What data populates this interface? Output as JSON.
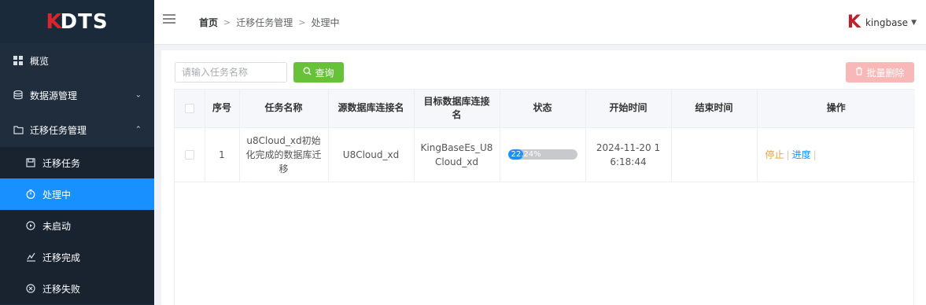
{
  "sidebar": {
    "logo_mark": "K",
    "logo_text": "DTS",
    "items": [
      {
        "label": "概览"
      },
      {
        "label": "数据源管理"
      },
      {
        "label": "迁移任务管理"
      }
    ],
    "sub_items": [
      {
        "label": "迁移任务"
      },
      {
        "label": "处理中"
      },
      {
        "label": "未启动"
      },
      {
        "label": "迁移完成"
      },
      {
        "label": "迁移失败"
      }
    ]
  },
  "breadcrumb": {
    "home": "首页",
    "level1": "迁移任务管理",
    "level2": "处理中"
  },
  "user": {
    "logo_mark": "K",
    "name": "kingbase"
  },
  "toolbar": {
    "search_placeholder": "请输入任务名称",
    "query_label": "查询",
    "batch_delete_label": "批量删除"
  },
  "table": {
    "columns": [
      "序号",
      "任务名称",
      "源数据库连接名",
      "目标数据库连接名",
      "状态",
      "开始时间",
      "结束时间",
      "操作"
    ],
    "rows": [
      {
        "index": "1",
        "task_name": "u8Cloud_xd初始化完成的数据库迁移",
        "source": "U8Cloud_xd",
        "target": "KingBaseEs_U8Cloud_xd",
        "progress_text": "22.24%",
        "progress_value": 22.24,
        "start_time": "2024-11-20 16:18:44",
        "end_time": "",
        "op_stop": "停止",
        "op_progress": "进度"
      }
    ]
  },
  "colors": {
    "sidebar_bg": "#1f2d3d",
    "active": "#1890ff",
    "query_btn": "#67c23a",
    "delete_btn": "#f9b8b8",
    "stop": "#e6a23c"
  }
}
